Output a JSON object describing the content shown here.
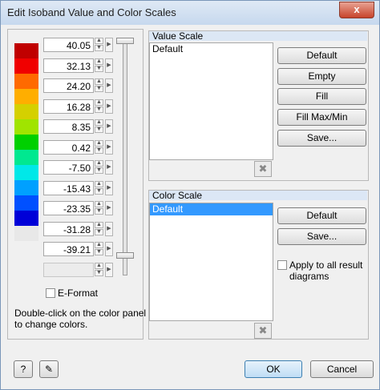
{
  "window": {
    "title": "Edit Isoband Value and Color Scales",
    "close_glyph": "x"
  },
  "scale": {
    "rows": [
      {
        "value": "40.05",
        "color": "#c00000"
      },
      {
        "value": "32.13",
        "color": "#f00000"
      },
      {
        "value": "24.20",
        "color": "#ff6a00"
      },
      {
        "value": "16.28",
        "color": "#ffae00"
      },
      {
        "value": "8.35",
        "color": "#d5d000"
      },
      {
        "value": "0.42",
        "color": "#a0e400"
      },
      {
        "value": "-7.50",
        "color": "#00d000"
      },
      {
        "value": "-15.43",
        "color": "#00e890"
      },
      {
        "value": "-23.35",
        "color": "#00e8e8"
      },
      {
        "value": "-31.28",
        "color": "#00a0ff"
      },
      {
        "value": "-39.21",
        "color": "#0050ff"
      },
      {
        "value": "",
        "color": "#0000d8"
      }
    ],
    "last_swatch_color": "#e8e8e8"
  },
  "eformat": {
    "label": "E-Format",
    "checked": false
  },
  "hint": {
    "line1": "Double-click on the color panel",
    "line2": "to change colors."
  },
  "value_scale": {
    "header": "Value Scale",
    "items": [
      "Default"
    ],
    "buttons": {
      "default": "Default",
      "empty": "Empty",
      "fill": "Fill",
      "fill_minmax": "Fill Max/Min",
      "save": "Save..."
    }
  },
  "color_scale": {
    "header": "Color Scale",
    "items": [
      "Default"
    ],
    "buttons": {
      "default": "Default",
      "save": "Save..."
    },
    "apply_all": {
      "line1": "Apply to all result",
      "line2": "diagrams",
      "checked": false
    }
  },
  "footer": {
    "ok": "OK",
    "cancel": "Cancel"
  }
}
